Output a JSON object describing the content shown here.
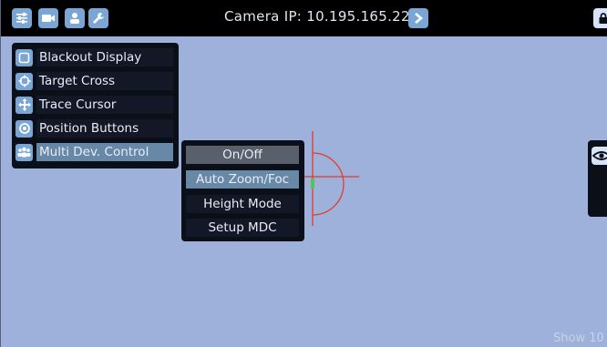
{
  "header": {
    "camera_ip": "Camera IP: 10.195.165.22",
    "icons": [
      "sliders-icon",
      "camera-icon",
      "user-icon",
      "wrench-icon"
    ]
  },
  "menu": {
    "items": [
      {
        "label": "Blackout Display",
        "icon": "square-icon"
      },
      {
        "label": "Target Cross",
        "icon": "crosshair-icon"
      },
      {
        "label": "Trace Cursor",
        "icon": "move-arrows-icon"
      },
      {
        "label": "Position Buttons",
        "icon": "circle-dot-icon"
      },
      {
        "label": "Multi Dev. Control",
        "icon": "group-icon"
      }
    ]
  },
  "submenu": {
    "items": [
      {
        "label": "On/Off"
      },
      {
        "label": "Auto Zoom/Foc"
      },
      {
        "label": "Height Mode"
      },
      {
        "label": "Setup MDC"
      }
    ]
  },
  "footer": {
    "show_text": "Show 10"
  },
  "colors": {
    "background": "#9db1db",
    "icon_blue": "#7aa6d6",
    "cross_red": "#e23b2e"
  }
}
